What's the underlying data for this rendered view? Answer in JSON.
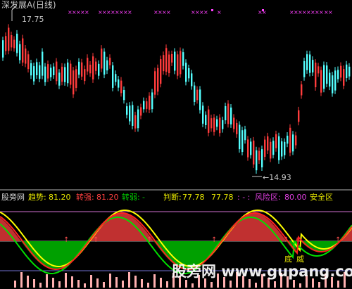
{
  "window": {
    "title": "深发展A(日线)"
  },
  "price_chart": {
    "high_label": "17.75",
    "low_label": "14.93"
  },
  "indicator": {
    "name": "股旁网",
    "trend_label": "趋势:",
    "trend_value": "81.20",
    "strong_label": "转强:",
    "strong_value": "81.20",
    "weak_label": "转弱:",
    "weak_value": "-",
    "judge_label": "判断:",
    "judge_value_1": "77.78",
    "judge_value_2": "77.78",
    "dash_text": ": - :",
    "risk_label": "风险区:",
    "risk_value": "80.00",
    "safe_label": "安全区",
    "buy_text": "底",
    "sell_text": "威"
  },
  "watermark": {
    "text": "股旁网",
    "url": "www.gupang.com"
  },
  "colors": {
    "background": "#000000",
    "up": "#ff3c3c",
    "down": "#54ffff",
    "magenta": "#ff40ff",
    "yellow": "#ffff00",
    "green": "#00c000",
    "red_fill": "#c03030"
  }
}
